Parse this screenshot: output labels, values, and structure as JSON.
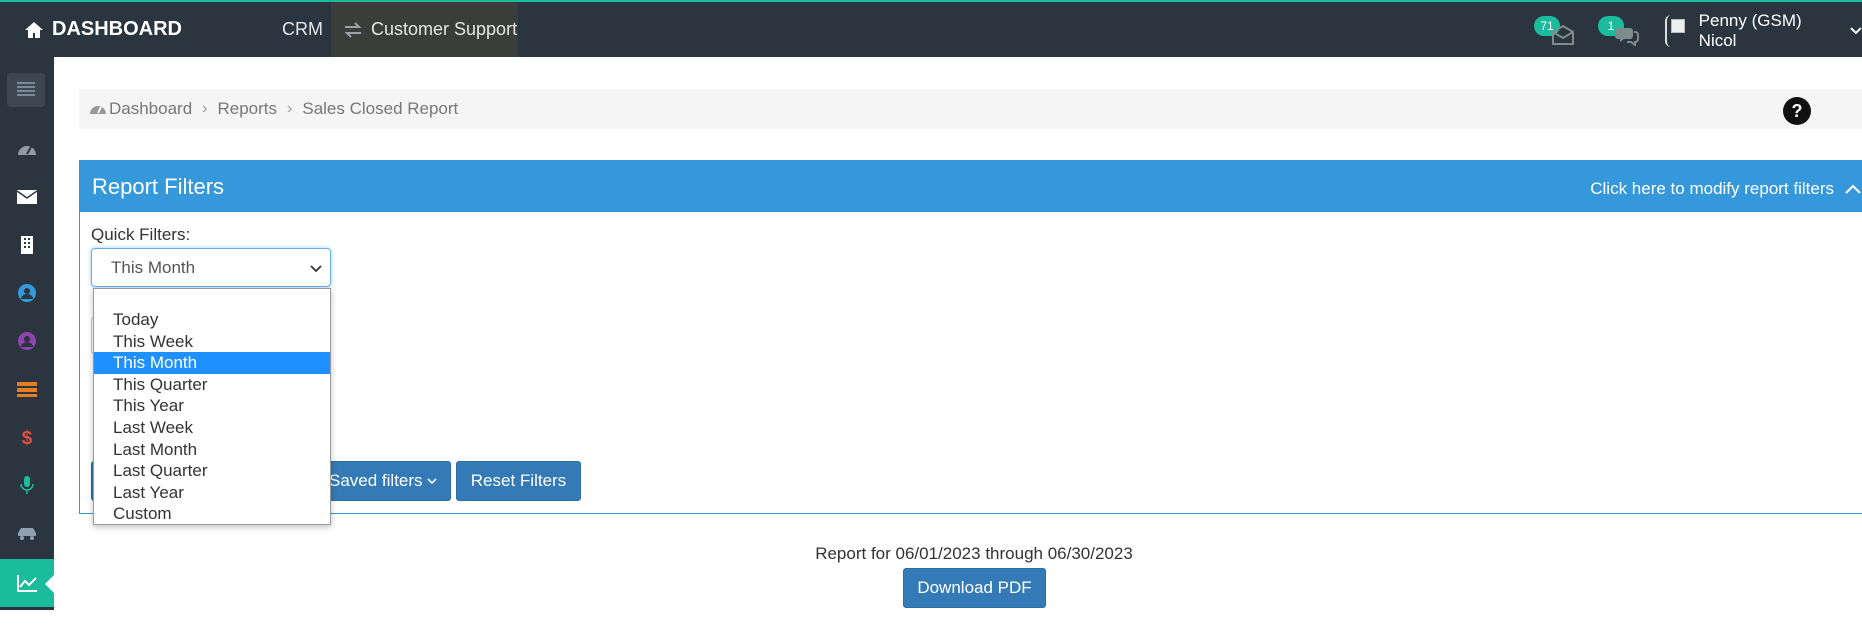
{
  "topbar": {
    "brand": "DASHBOARD",
    "nav": {
      "crm": "CRM",
      "customer_support": "Customer Support"
    },
    "notifications": {
      "mail_count": "71",
      "chat_count": "1"
    },
    "user_name": "Penny (GSM) Nicol",
    "icons": [
      "home-icon",
      "exchange-icon",
      "envelope-icon",
      "comments-icon",
      "chevron-down-icon"
    ]
  },
  "sidebar": {
    "items": [
      {
        "icon": "menu-toggle-icon",
        "color": "#8fa0b0"
      },
      {
        "icon": "dashboard-icon",
        "color": "#8f9ba6"
      },
      {
        "icon": "envelope-icon",
        "color": "#ffffff"
      },
      {
        "icon": "building-icon",
        "color": "#ffffff"
      },
      {
        "icon": "user-circle-icon",
        "color": "#3498db"
      },
      {
        "icon": "user-circle-icon",
        "color": "#8e44ad"
      },
      {
        "icon": "tasks-icon",
        "color": "#e67e22"
      },
      {
        "icon": "dollar-icon",
        "color": "#e74c3c"
      },
      {
        "icon": "microphone-icon",
        "color": "#1abc9c"
      },
      {
        "icon": "car-icon",
        "color": "#8fa0b0"
      },
      {
        "icon": "line-chart-icon",
        "color": "#ffffff"
      }
    ]
  },
  "breadcrumb": {
    "items": [
      "Dashboard",
      "Reports",
      "Sales Closed Report"
    ]
  },
  "panel": {
    "title": "Report Filters",
    "toggle_label": "Click here to modify report filters"
  },
  "quick_filters": {
    "label": "Quick Filters:",
    "selected": "This Month",
    "options": [
      "",
      "Today",
      "This Week",
      "This Month",
      "This Quarter",
      "This Year",
      "Last Week",
      "Last Month",
      "Last Quarter",
      "Last Year",
      "Custom"
    ]
  },
  "buttons": {
    "saved_filters": "Saved filters",
    "reset_filters": "Reset Filters",
    "download_pdf": "Download PDF"
  },
  "report_range": "Report for 06/01/2023 through 06/30/2023",
  "colors": {
    "navbar": "#2a3540",
    "accent": "#1abc9c",
    "panel": "#3498db",
    "button": "#337ab7",
    "selected_option": "#1e90ff"
  }
}
